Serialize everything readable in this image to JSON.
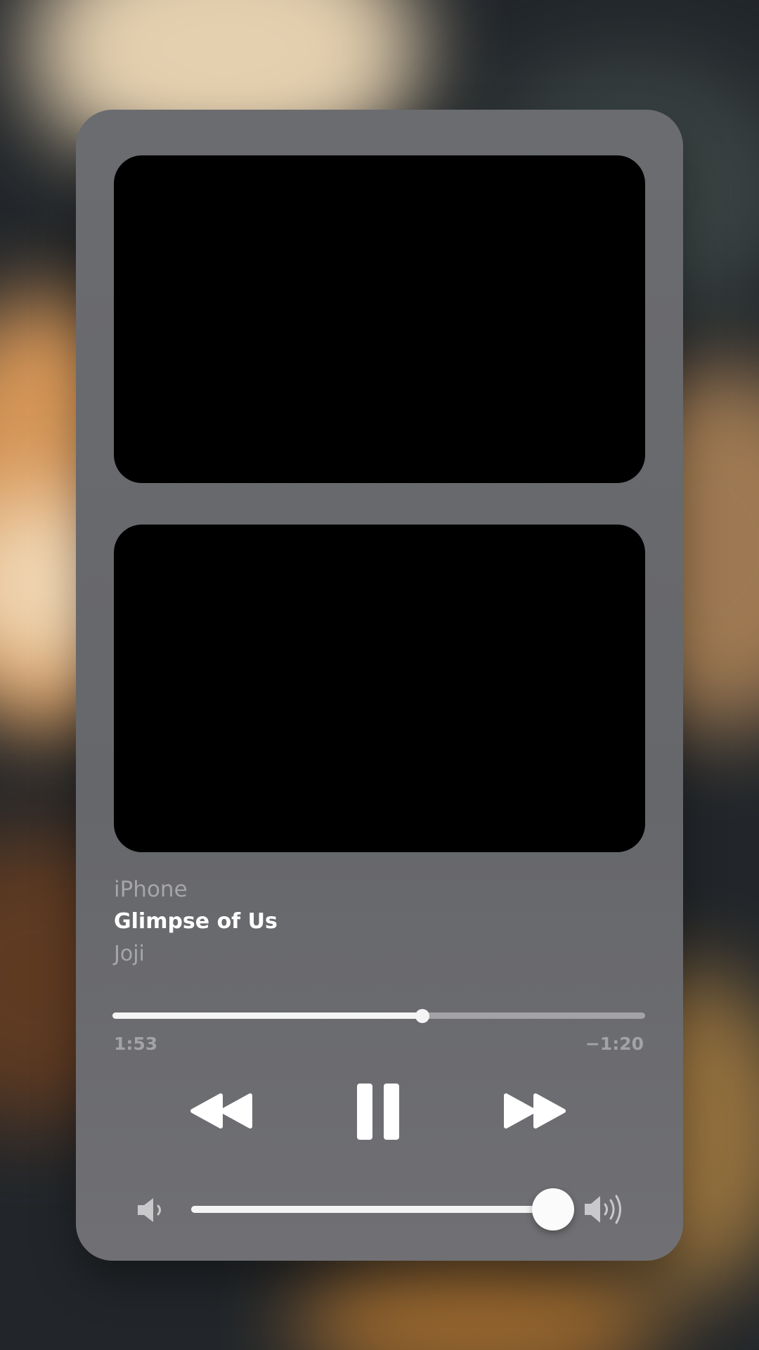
{
  "now_playing": {
    "device": "iPhone",
    "title": "Glimpse of Us",
    "artist": "Joji"
  },
  "playback": {
    "elapsed": "1:53",
    "remaining": "−1:20",
    "progress_fraction": 0.5816,
    "state": "playing"
  },
  "volume": {
    "level_fraction": 0.98
  },
  "icons": {
    "rewind": "rewind-icon",
    "pause": "pause-icon",
    "forward": "fast-forward-icon",
    "volume_low": "speaker-low-icon",
    "volume_high": "speaker-high-icon"
  },
  "colors": {
    "card_background": "#6b6c70",
    "artwork_placeholder": "#000000",
    "primary_text": "#ffffff",
    "secondary_text": "#a6a6a9",
    "track_fill": "#f4f4f5",
    "track_background": "#a3a3a6"
  }
}
